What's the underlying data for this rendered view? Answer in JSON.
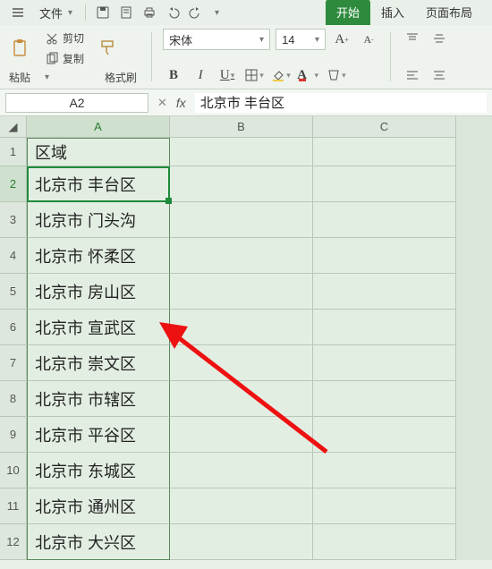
{
  "menubar": {
    "file_label": "文件",
    "hamburger_icon": "hamburger-icon",
    "qa_icons": [
      "save-icon",
      "print-preview-icon",
      "print-icon",
      "undo-icon",
      "redo-icon"
    ]
  },
  "ribbon_tabs": {
    "start": "开始",
    "insert": "插入",
    "page_layout": "页面布局"
  },
  "clipboard": {
    "paste": "粘贴",
    "cut": "剪切",
    "copy": "复制",
    "format_painter": "格式刷"
  },
  "font": {
    "family": "宋体",
    "size": "14",
    "increase": "A",
    "decrease": "A",
    "bold": "B",
    "italic": "I",
    "underline": "U",
    "border_icon": "border-icon",
    "fill_icon": "fill-icon",
    "font_color_icon": "font-color-icon"
  },
  "alignment": {
    "icons": [
      "align-top",
      "align-middle",
      "align-left",
      "align-center"
    ]
  },
  "namebox": {
    "value": "A2"
  },
  "formulabar": {
    "fx": "fx",
    "value": "北京市  丰台区"
  },
  "columns": [
    "A",
    "B",
    "C"
  ],
  "rows": [
    {
      "n": "1",
      "a": "区域"
    },
    {
      "n": "2",
      "a": "北京市  丰台区"
    },
    {
      "n": "3",
      "a": "北京市  门头沟"
    },
    {
      "n": "4",
      "a": "北京市  怀柔区"
    },
    {
      "n": "5",
      "a": "北京市  房山区"
    },
    {
      "n": "6",
      "a": "北京市  宣武区"
    },
    {
      "n": "7",
      "a": "北京市  崇文区"
    },
    {
      "n": "8",
      "a": "北京市  市辖区"
    },
    {
      "n": "9",
      "a": "北京市  平谷区"
    },
    {
      "n": "10",
      "a": "北京市  东城区"
    },
    {
      "n": "11",
      "a": "北京市  通州区"
    },
    {
      "n": "12",
      "a": "北京市  大兴区"
    }
  ]
}
